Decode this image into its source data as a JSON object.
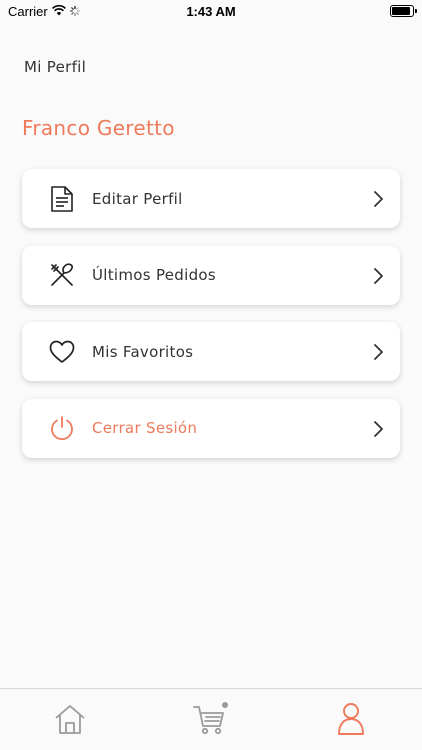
{
  "status_bar": {
    "carrier": "Carrier",
    "time": "1:43 AM"
  },
  "header": {
    "title": "Mi Perfil",
    "user_name": "Franco Geretto"
  },
  "menu": {
    "items": [
      {
        "label": "Editar Perfil",
        "icon": "document-icon"
      },
      {
        "label": "Últimos Pedidos",
        "icon": "utensils-icon"
      },
      {
        "label": "Mis Favoritos",
        "icon": "heart-icon"
      },
      {
        "label": "Cerrar Sesión",
        "icon": "power-icon"
      }
    ]
  },
  "tabbar": {
    "tabs": [
      {
        "name": "home",
        "icon": "home-icon",
        "active": false
      },
      {
        "name": "cart",
        "icon": "cart-icon",
        "active": false
      },
      {
        "name": "profile",
        "icon": "user-icon",
        "active": true
      }
    ]
  },
  "colors": {
    "accent": "#ef7a5c",
    "text": "#333333",
    "icon_inactive": "#9a9a9a",
    "background": "#fafafa"
  }
}
